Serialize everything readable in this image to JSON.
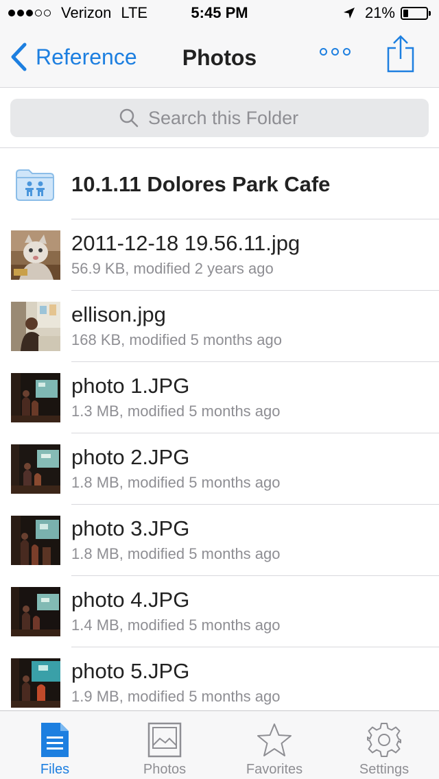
{
  "status_bar": {
    "carrier": "Verizon",
    "network": "LTE",
    "time": "5:45 PM",
    "battery_percent": "21%",
    "battery_level": 0.21,
    "signal_bars_filled": 3,
    "signal_bars_total": 5
  },
  "nav": {
    "back_label": "Reference",
    "title": "Photos",
    "more_icon": "more-options-icon",
    "share_icon": "share-icon"
  },
  "search": {
    "placeholder": "Search this Folder"
  },
  "folder": {
    "name": "10.1.11 Dolores Park Cafe",
    "icon": "shared-folder-icon"
  },
  "files": [
    {
      "name": "2011-12-18 19.56.11.jpg",
      "meta": "56.9 KB, modified 2 years ago",
      "thumb": "kitten"
    },
    {
      "name": "ellison.jpg",
      "meta": "168 KB, modified 5 months ago",
      "thumb": "person-room"
    },
    {
      "name": "photo 1.JPG",
      "meta": "1.3 MB, modified 5 months ago",
      "thumb": "stage"
    },
    {
      "name": "photo 2.JPG",
      "meta": "1.8 MB, modified 5 months ago",
      "thumb": "stage"
    },
    {
      "name": "photo 3.JPG",
      "meta": "1.8 MB, modified 5 months ago",
      "thumb": "stage"
    },
    {
      "name": "photo 4.JPG",
      "meta": "1.4 MB, modified 5 months ago",
      "thumb": "stage"
    },
    {
      "name": "photo 5.JPG",
      "meta": "1.9 MB, modified 5 months ago",
      "thumb": "stage"
    }
  ],
  "tabs": [
    {
      "label": "Files",
      "icon": "files-icon",
      "active": true
    },
    {
      "label": "Photos",
      "icon": "photos-icon",
      "active": false
    },
    {
      "label": "Favorites",
      "icon": "star-icon",
      "active": false
    },
    {
      "label": "Settings",
      "icon": "gear-icon",
      "active": false
    }
  ],
  "colors": {
    "accent": "#1d7fe0",
    "secondary_text": "#8e8e93",
    "bar_background": "#f7f7f8"
  }
}
